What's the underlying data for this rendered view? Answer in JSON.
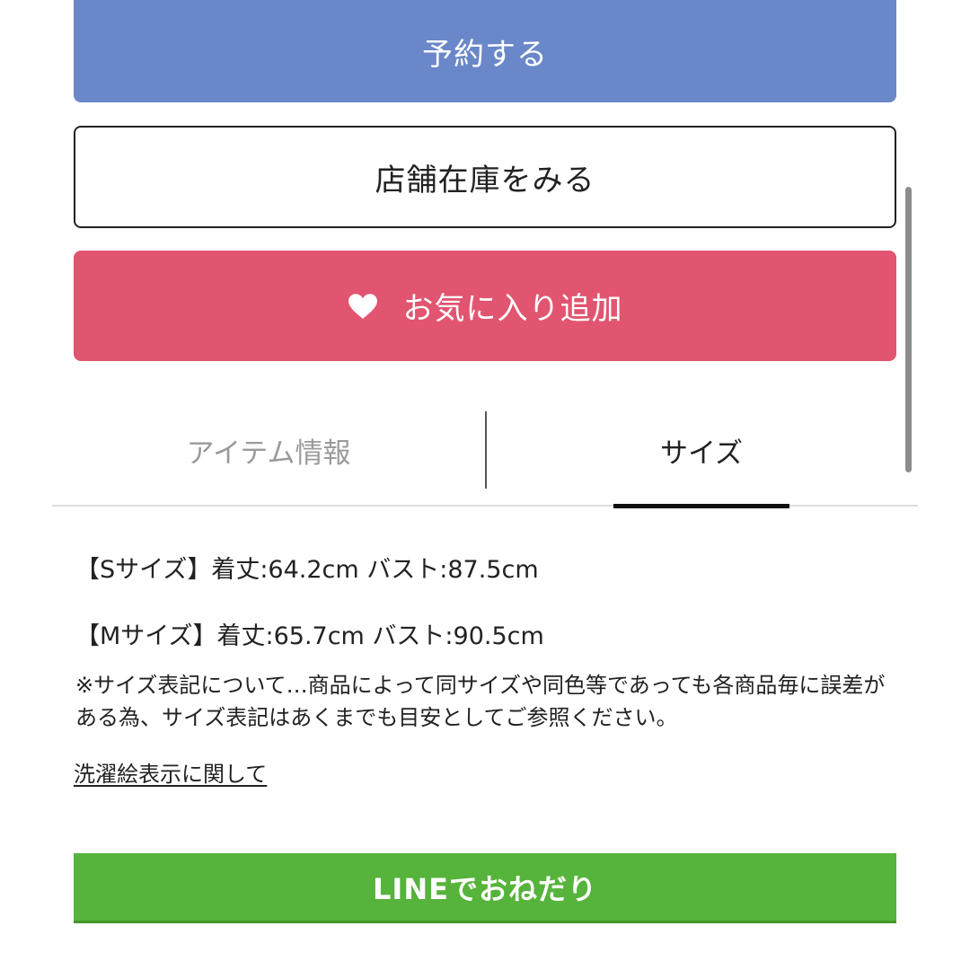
{
  "buttons": {
    "reserve": "予約する",
    "store_stock": "店舗在庫をみる",
    "favorite": "お気に入り追加",
    "line": "LINEでおねだり"
  },
  "tabs": {
    "item_info": "アイテム情報",
    "size": "サイズ",
    "active": "サイズ"
  },
  "sizes": {
    "s": "【Sサイズ】着丈:64.2cm バスト:87.5cm",
    "m": "【Mサイズ】着丈:65.7cm バスト:90.5cm"
  },
  "note": "※サイズ表記について…商品によって同サイズや同色等であっても各商品毎に誤差がある為、サイズ表記はあくまでも目安としてご参照ください。",
  "wash_link": "洗濯絵表示に関して",
  "colors": {
    "reserve": "#6a87c9",
    "favorite": "#e15570",
    "line": "#56b33b"
  },
  "icons": {
    "favorite": "heart-icon"
  }
}
